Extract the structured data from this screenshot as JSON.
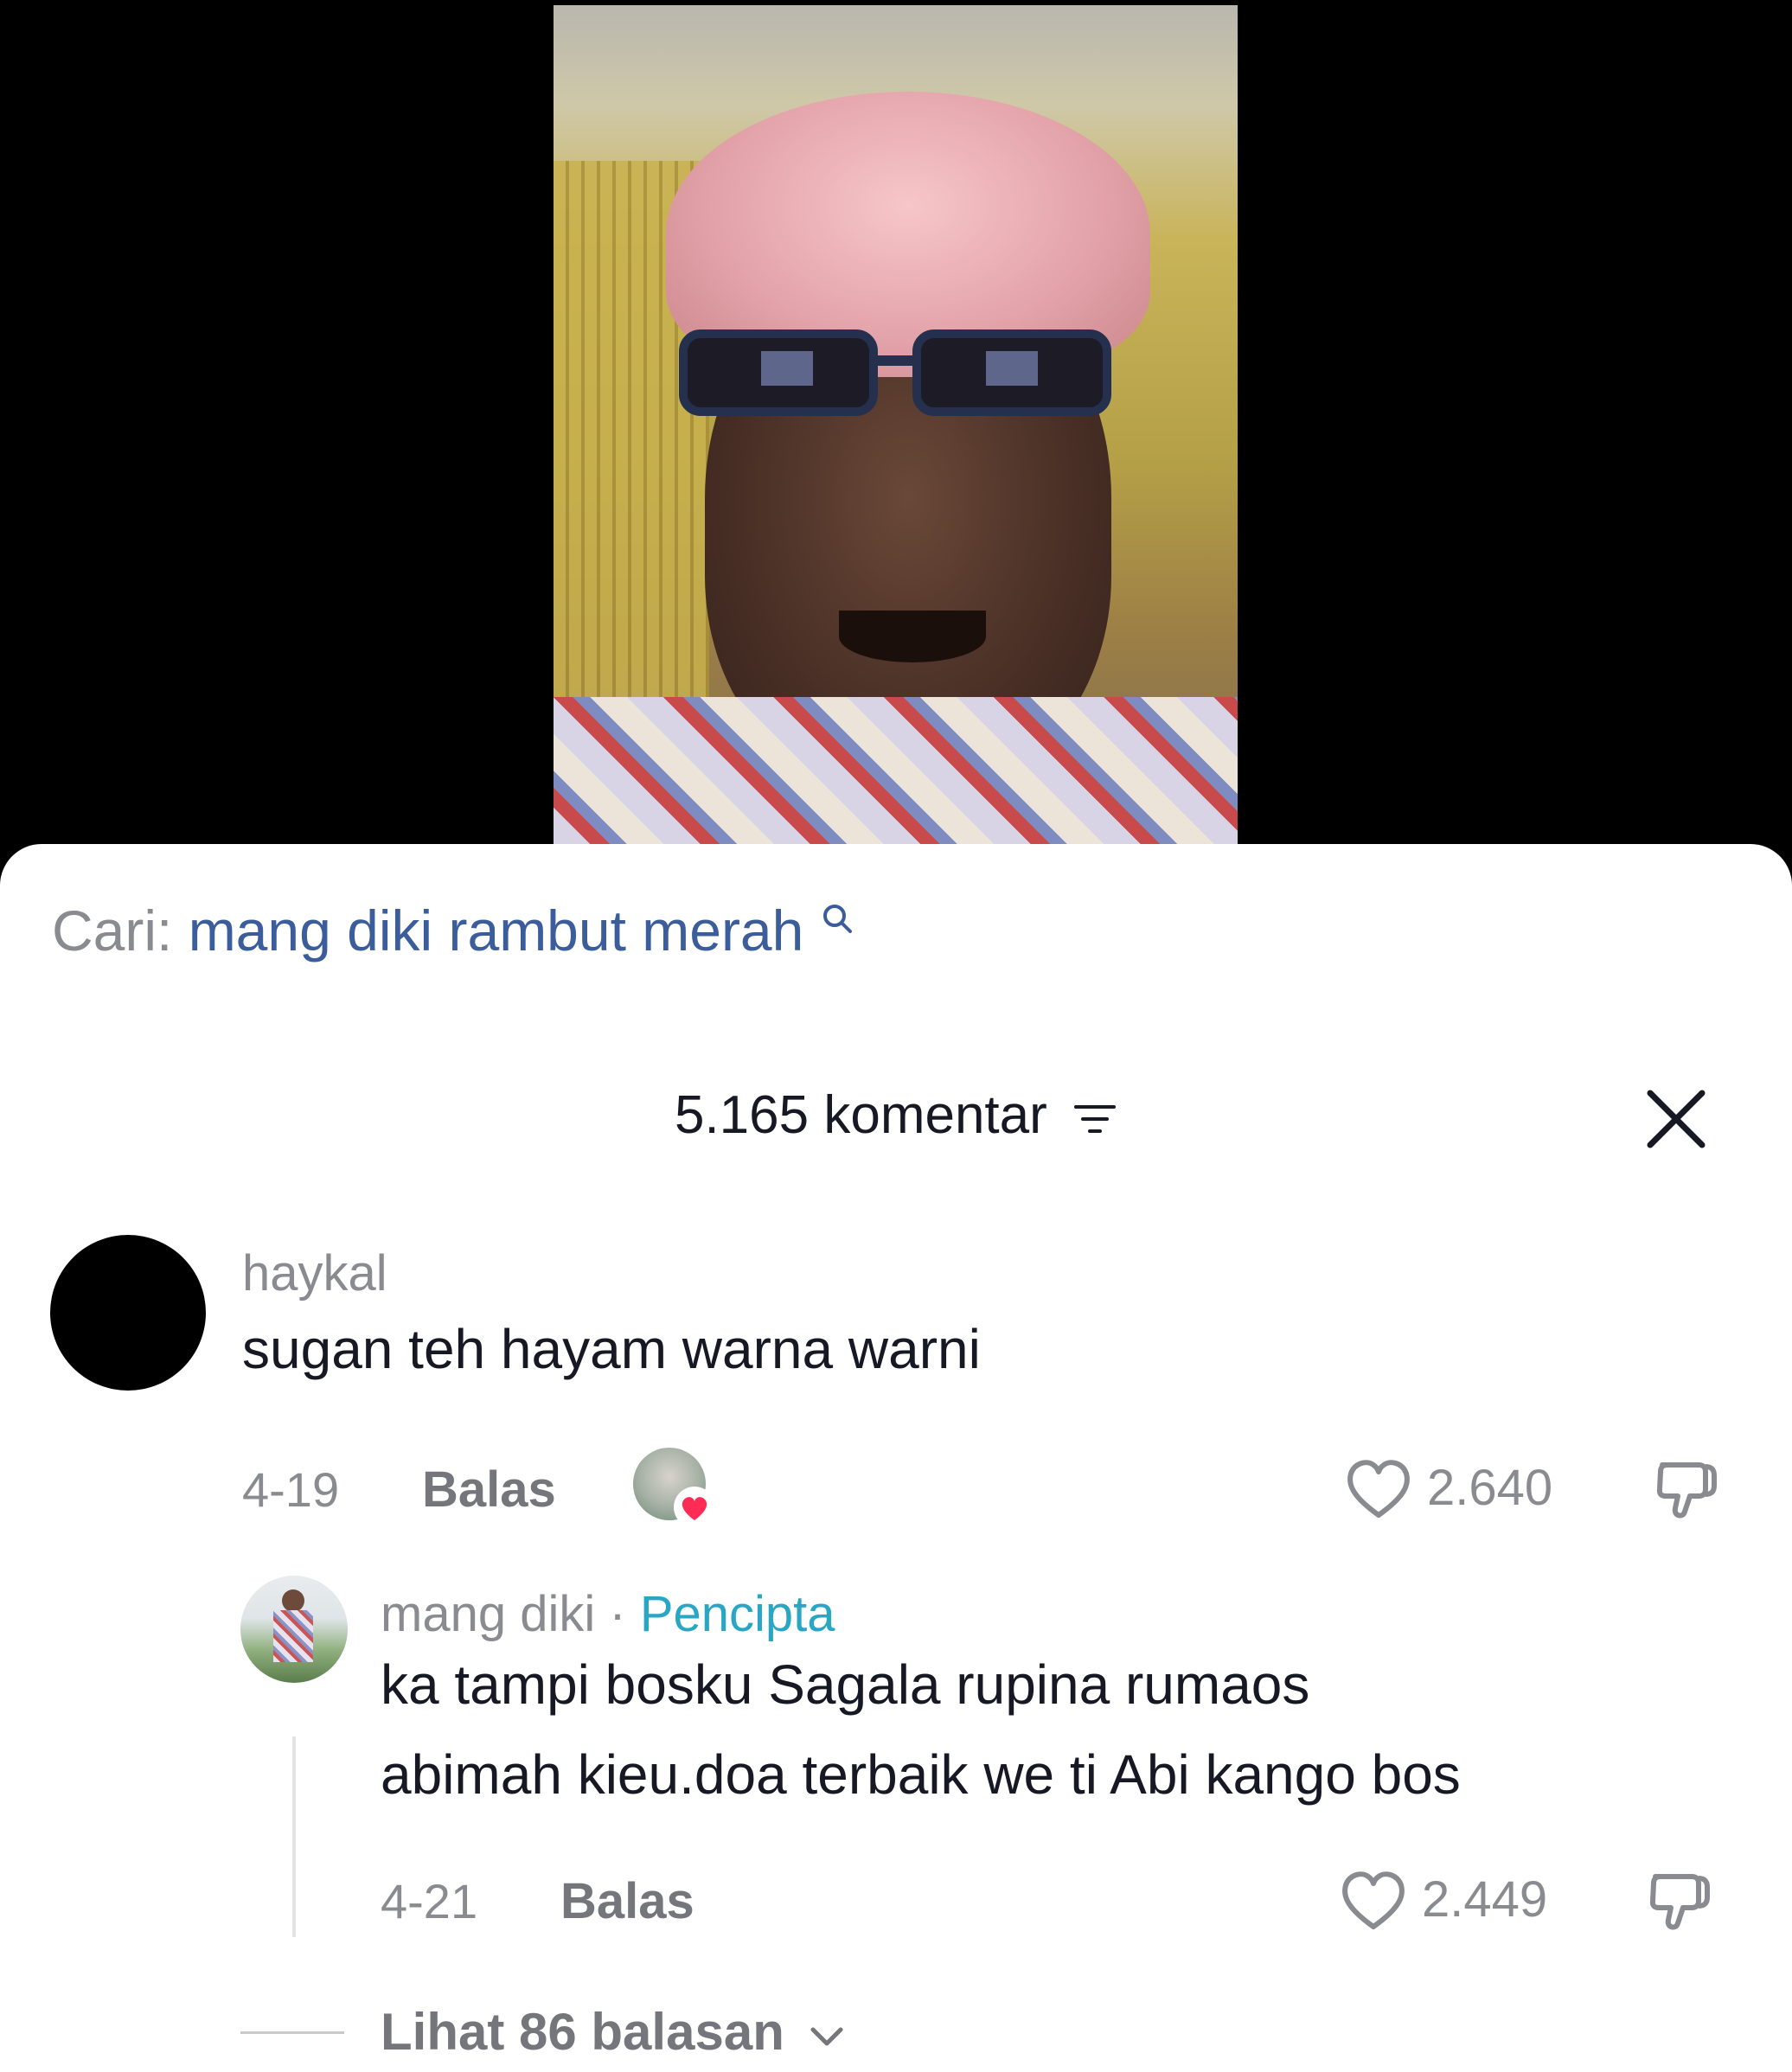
{
  "video": {
    "description_icon": "video-thumbnail"
  },
  "search": {
    "prefix": "Cari:",
    "term": "mang diki rambut merah"
  },
  "comments_header": {
    "title": "5.165 komentar"
  },
  "comments": [
    {
      "username": "haykal",
      "text": "sugan teh hayam warna warni",
      "date": "4-19",
      "reply_label": "Balas",
      "likes": "2.640",
      "liked_by_creator": true
    }
  ],
  "reply": {
    "username": "mang diki",
    "separator": "·",
    "badge": "Pencipta",
    "text_line1": "ka tampi bosku Sagala rupina rumaos",
    "text_line2": "abimah kieu.doa terbaik we ti Abi kango bos",
    "date": "4-21",
    "reply_label": "Balas",
    "likes": "2.449"
  },
  "more_replies": {
    "label": "Lihat 86 balasan"
  },
  "colors": {
    "search_term": "#3b5d9b",
    "creator_badge": "#29a6c4",
    "muted": "#8a8b91",
    "text": "#161823"
  }
}
